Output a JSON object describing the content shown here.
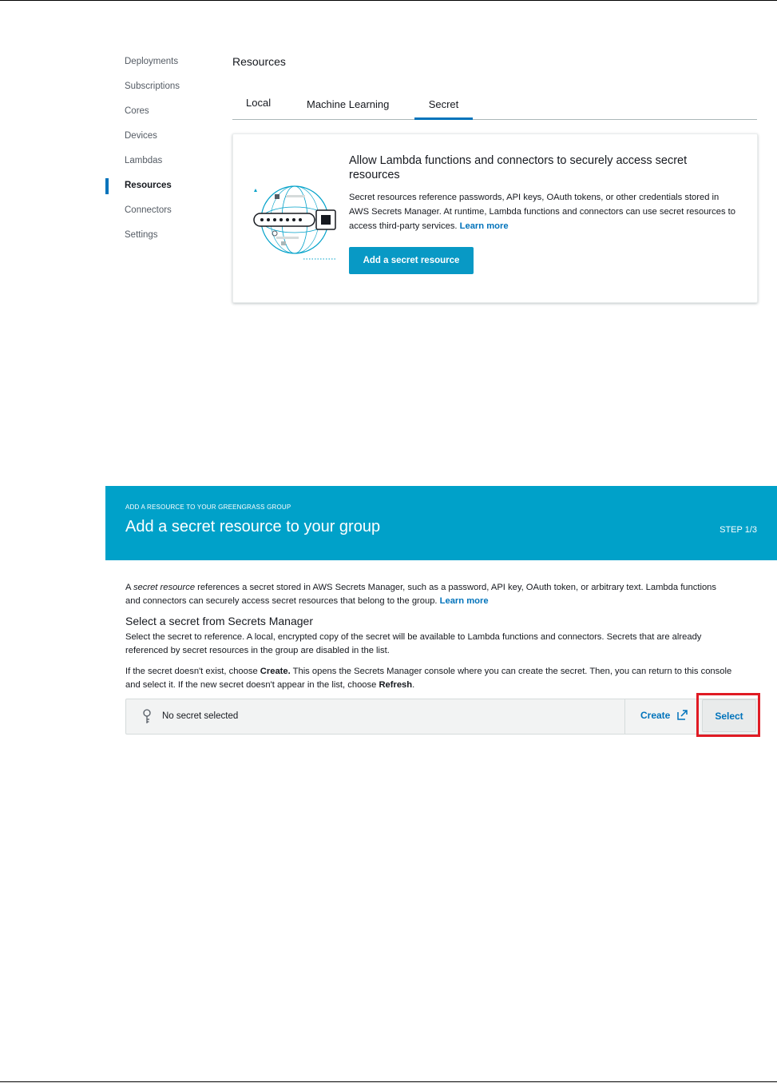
{
  "sidebar": {
    "items": [
      {
        "label": "Deployments",
        "active": false
      },
      {
        "label": "Subscriptions",
        "active": false
      },
      {
        "label": "Cores",
        "active": false
      },
      {
        "label": "Devices",
        "active": false
      },
      {
        "label": "Lambdas",
        "active": false
      },
      {
        "label": "Resources",
        "active": true
      },
      {
        "label": "Connectors",
        "active": false
      },
      {
        "label": "Settings",
        "active": false
      }
    ]
  },
  "resources": {
    "title": "Resources",
    "tabs": [
      "Local",
      "Machine Learning",
      "Secret"
    ],
    "active_tab": "Secret",
    "card": {
      "title": "Allow Lambda functions and connectors to securely access secret resources",
      "body": "Secret resources reference passwords, API keys, OAuth tokens, or other credentials stored in AWS Secrets Manager. At runtime, Lambda functions and connectors can use secret resources to access third-party services.",
      "link": "Learn more",
      "button": "Add a secret resource",
      "illustration_icon": "secret-lock-globe-icon"
    }
  },
  "wizard": {
    "eyebrow": "ADD A RESOURCE TO YOUR GREENGRASS GROUP",
    "title": "Add a secret resource to your group",
    "step": "STEP 1/3",
    "intro_prefix": "A ",
    "intro_em": "secret resource",
    "intro_rest": " references a secret stored in AWS Secrets Manager, such as a password, API key, OAuth token, or arbitrary text. Lambda functions and connectors can securely access secret resources that belong to the group.",
    "intro_link": "Learn more",
    "subheading": "Select a secret from Secrets Manager",
    "desc1": "Select the secret to reference. A local, encrypted copy of the secret will be available to Lambda functions and connectors. Secrets that are already referenced by secret resources in the group are disabled in the list.",
    "desc2_a": "If the secret doesn't exist, choose ",
    "desc2_b": "Create.",
    "desc2_c": " This opens the Secrets Manager console where you can create the secret. Then, you can return to this console and select it. If the new secret doesn't appear in the list, choose ",
    "desc2_d": "Refresh",
    "desc2_e": ".",
    "selector": {
      "icon": "key-icon",
      "value": "No secret selected",
      "create_label": "Create",
      "create_icon": "external-link-icon",
      "select_label": "Select"
    }
  },
  "colors": {
    "accent": "#0073bb",
    "header_bg": "#00a1c9",
    "primary_button": "#0899c5",
    "highlight": "#e01b24"
  }
}
